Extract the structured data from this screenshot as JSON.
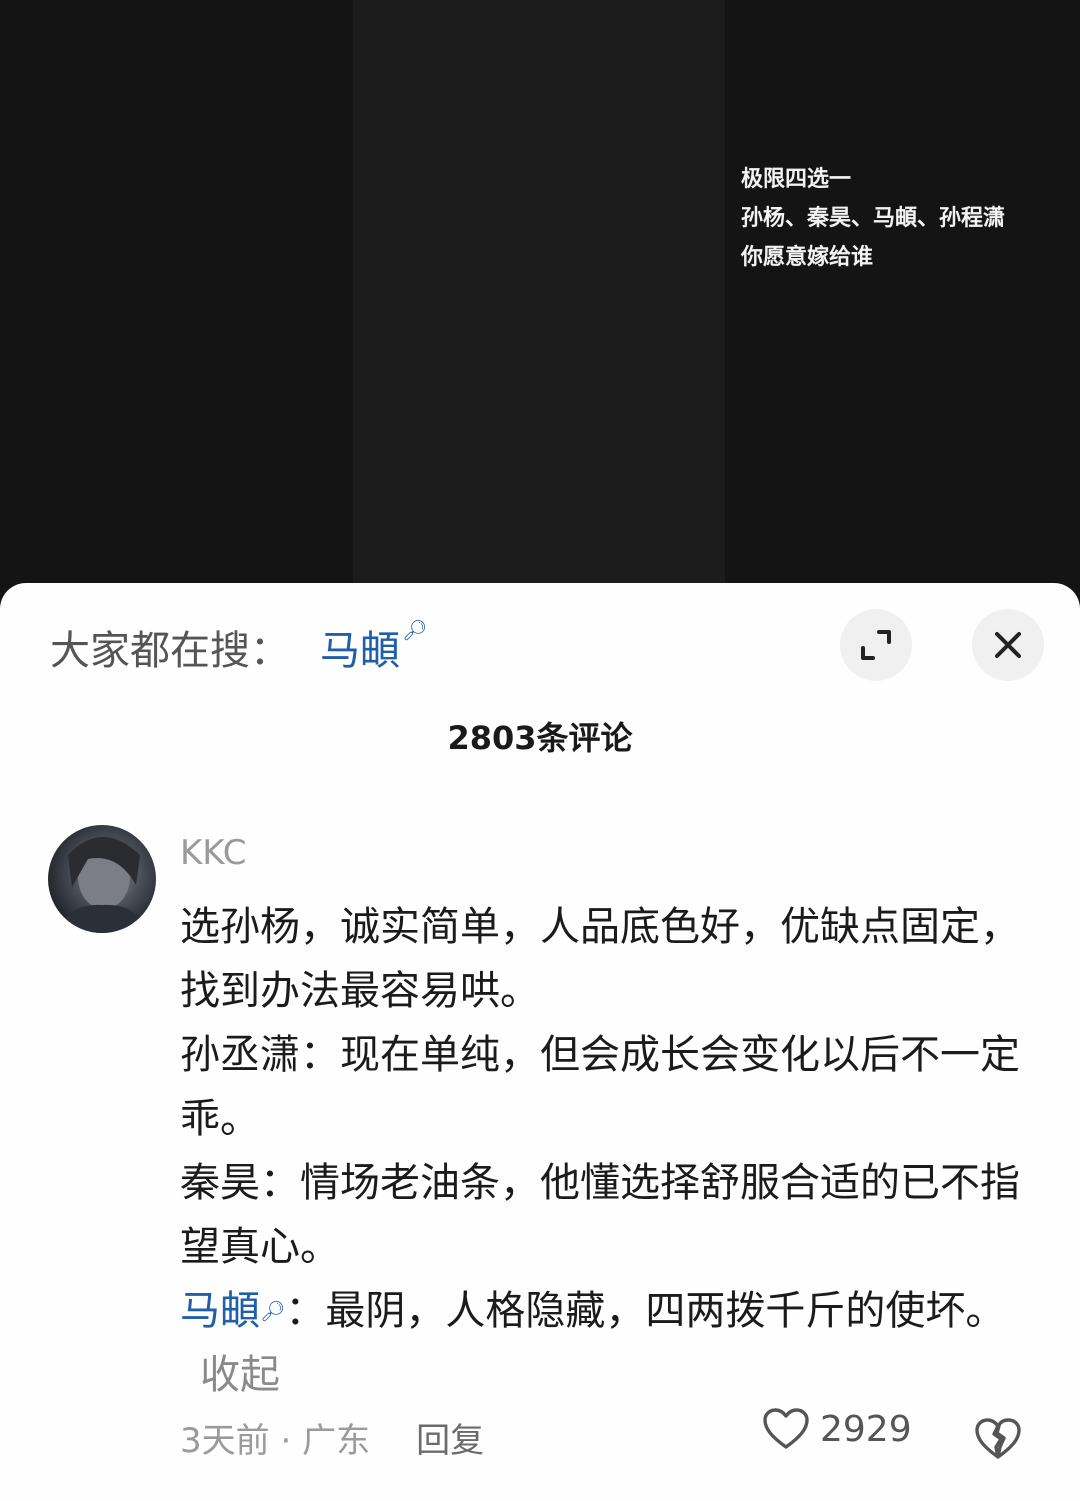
{
  "video": {
    "caption_lines": [
      "极限四选一",
      "孙杨、秦昊、马頔、孙程潇",
      "你愿意嫁给谁"
    ]
  },
  "sheet": {
    "search_prefix": "大家都在搜：",
    "search_term": "马頔",
    "search_icon": "search-icon",
    "expand_icon": "expand-icon",
    "close_icon": "close-icon",
    "comment_count": "2803条评论"
  },
  "comment": {
    "username": "KKC",
    "line1": "选孙杨，诚实简单，人品底色好，优缺点固定，找到办法最容易哄。",
    "line2": "孙丞潇：现在单纯，但会成长会变化以后不一定乖。",
    "line3": "秦昊：情场老油条，他懂选择舒服合适的已不指望真心。",
    "line4_link": "马頔",
    "line4_rest": "：最阴，人格隐藏，四两拨千斤的使坏。",
    "collapse": "收起",
    "time": "3天前",
    "separator": " · ",
    "location": "广东",
    "reply": "回复",
    "like_count": "2929",
    "like_icon": "heart-icon",
    "dislike_icon": "broken-heart-icon"
  },
  "colors": {
    "link": "#1f5fa8",
    "background_dark": "#141414",
    "sheet": "#fefefe"
  }
}
